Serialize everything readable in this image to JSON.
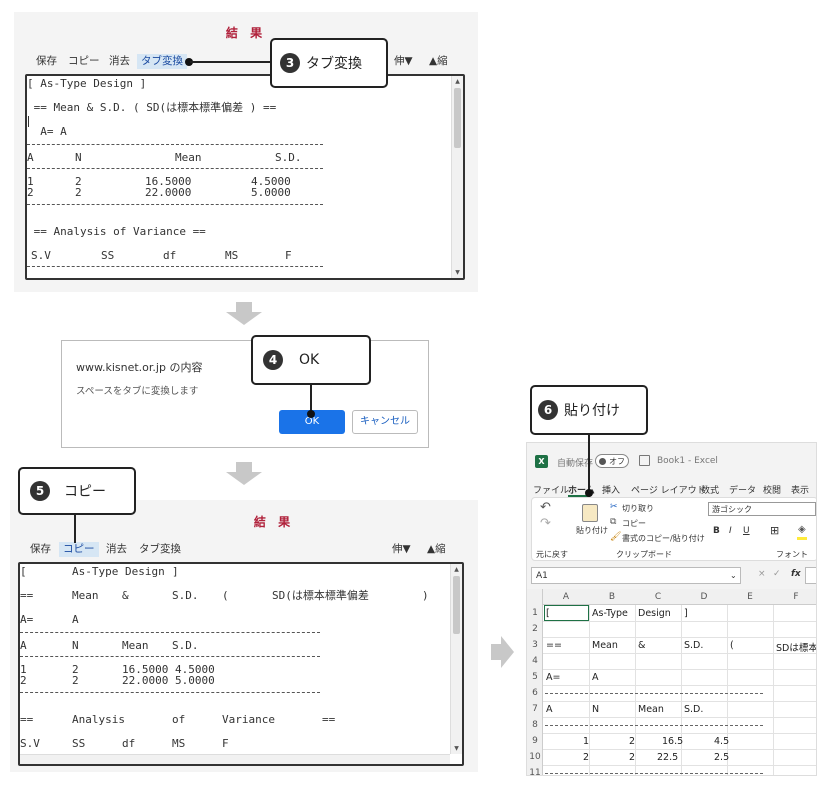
{
  "panel1": {
    "title": "結 果",
    "toolbar": {
      "save": "保存",
      "copy": "コピー",
      "clear": "消去",
      "tab_convert": "タブ変換",
      "expand": "伸▼",
      "shrink": "▲縮"
    },
    "lines": {
      "l1": "[ As-Type Design ]",
      "l2": " == Mean & S.D. ( SD(は標本標準偏差 ) ==",
      "l3": "  A= A",
      "h_a": "A",
      "h_n": "N",
      "h_mean": "Mean",
      "h_sd": "S.D.",
      "r1_a": "1",
      "r1_n": "2",
      "r1_mean": "16.5000",
      "r1_sd": "4.5000",
      "r2_a": "2",
      "r2_n": "2",
      "r2_mean": "22.0000",
      "r2_sd": "5.0000",
      "l4": " == Analysis of Variance ==",
      "a_sv": "S.V",
      "a_ss": "SS",
      "a_df": "df",
      "a_ms": "MS",
      "a_f": "F"
    }
  },
  "callout3": {
    "num": "3",
    "label": "タブ変換"
  },
  "dialog": {
    "site": "www.kisnet.or.jp の内容",
    "message": "スペースをタブに変換します",
    "ok": "OK",
    "cancel": "キャンセル"
  },
  "callout4": {
    "num": "4",
    "label": "OK"
  },
  "callout5": {
    "num": "5",
    "label": "コピー"
  },
  "panel2": {
    "title": "結 果",
    "toolbar": {
      "save": "保存",
      "copy": "コピー",
      "clear": "消去",
      "tab_convert": "タブ変換",
      "expand": "伸▼",
      "shrink": "▲縮"
    },
    "lines": {
      "t1a": "[",
      "t1b": "As-Type Design",
      "t1c": "]",
      "t2a": "==",
      "t2b": "Mean",
      "t2c": "&",
      "t2d": "S.D.",
      "t2e": "(",
      "t2f": "SD(は標本標準偏差",
      "t2g": ")",
      "t3a": "A=",
      "t3b": "A",
      "h_a": "A",
      "h_n": "N",
      "h_mean": "Mean",
      "h_sd": "S.D.",
      "r1_a": "1",
      "r1_n": "2",
      "r1_vals": "16.5000 4.5000",
      "r2_a": "2",
      "r2_n": "2",
      "r2_vals": "22.0000 5.0000",
      "t4a": "==",
      "t4b": "Analysis",
      "t4c": "of",
      "t4d": "Variance",
      "t4e": "==",
      "a_sv": "S.V",
      "a_ss": "SS",
      "a_df": "df",
      "a_ms": "MS",
      "a_f": "F"
    }
  },
  "callout6": {
    "num": "6",
    "label": "貼り付け"
  },
  "excel": {
    "autosave": "自動保存",
    "toggle": "オフ",
    "book": "Book1 - Excel",
    "tabs": [
      "ファイル",
      "ホーム",
      "挿入",
      "ページ レイアウト",
      "数式",
      "データ",
      "校閲",
      "表示"
    ],
    "undo_label": "元に戻す",
    "paste_label": "貼り付け",
    "cut": "切り取り",
    "copy": "コピー",
    "format_copy": "書式のコピー/貼り付け",
    "clipboard": "クリップボード",
    "font_name": "游ゴシック",
    "font_group": "フォント",
    "namebox": "A1",
    "fx": "fx",
    "cols": [
      "A",
      "B",
      "C",
      "D",
      "E",
      "F"
    ],
    "rows": [
      "1",
      "2",
      "3",
      "4",
      "5",
      "6",
      "7",
      "8",
      "9",
      "10",
      "11"
    ],
    "cells": {
      "r1a": "[",
      "r1b": "As-Type",
      "r1c": "Design",
      "r1d": "]",
      "r3a": "==",
      "r3b": "Mean",
      "r3c": "&",
      "r3d": "S.D.",
      "r3e": "(",
      "r3f": "SDは標本",
      "r5a": "A=",
      "r5b": "A",
      "r7a": "A",
      "r7b": "N",
      "r7c": "Mean",
      "r7d": "S.D.",
      "r9a": "1",
      "r9b": "2",
      "r9c": "16.5",
      "r9d": "4.5",
      "r10a": "2",
      "r10b": "2",
      "r10c": "22.5",
      "r10d": "2.5"
    }
  },
  "colors": {
    "title_red": "#b0203a",
    "ok_blue": "#1a73e8",
    "excel_green": "#1e7145",
    "arrow_gray": "#c8c8c8"
  }
}
